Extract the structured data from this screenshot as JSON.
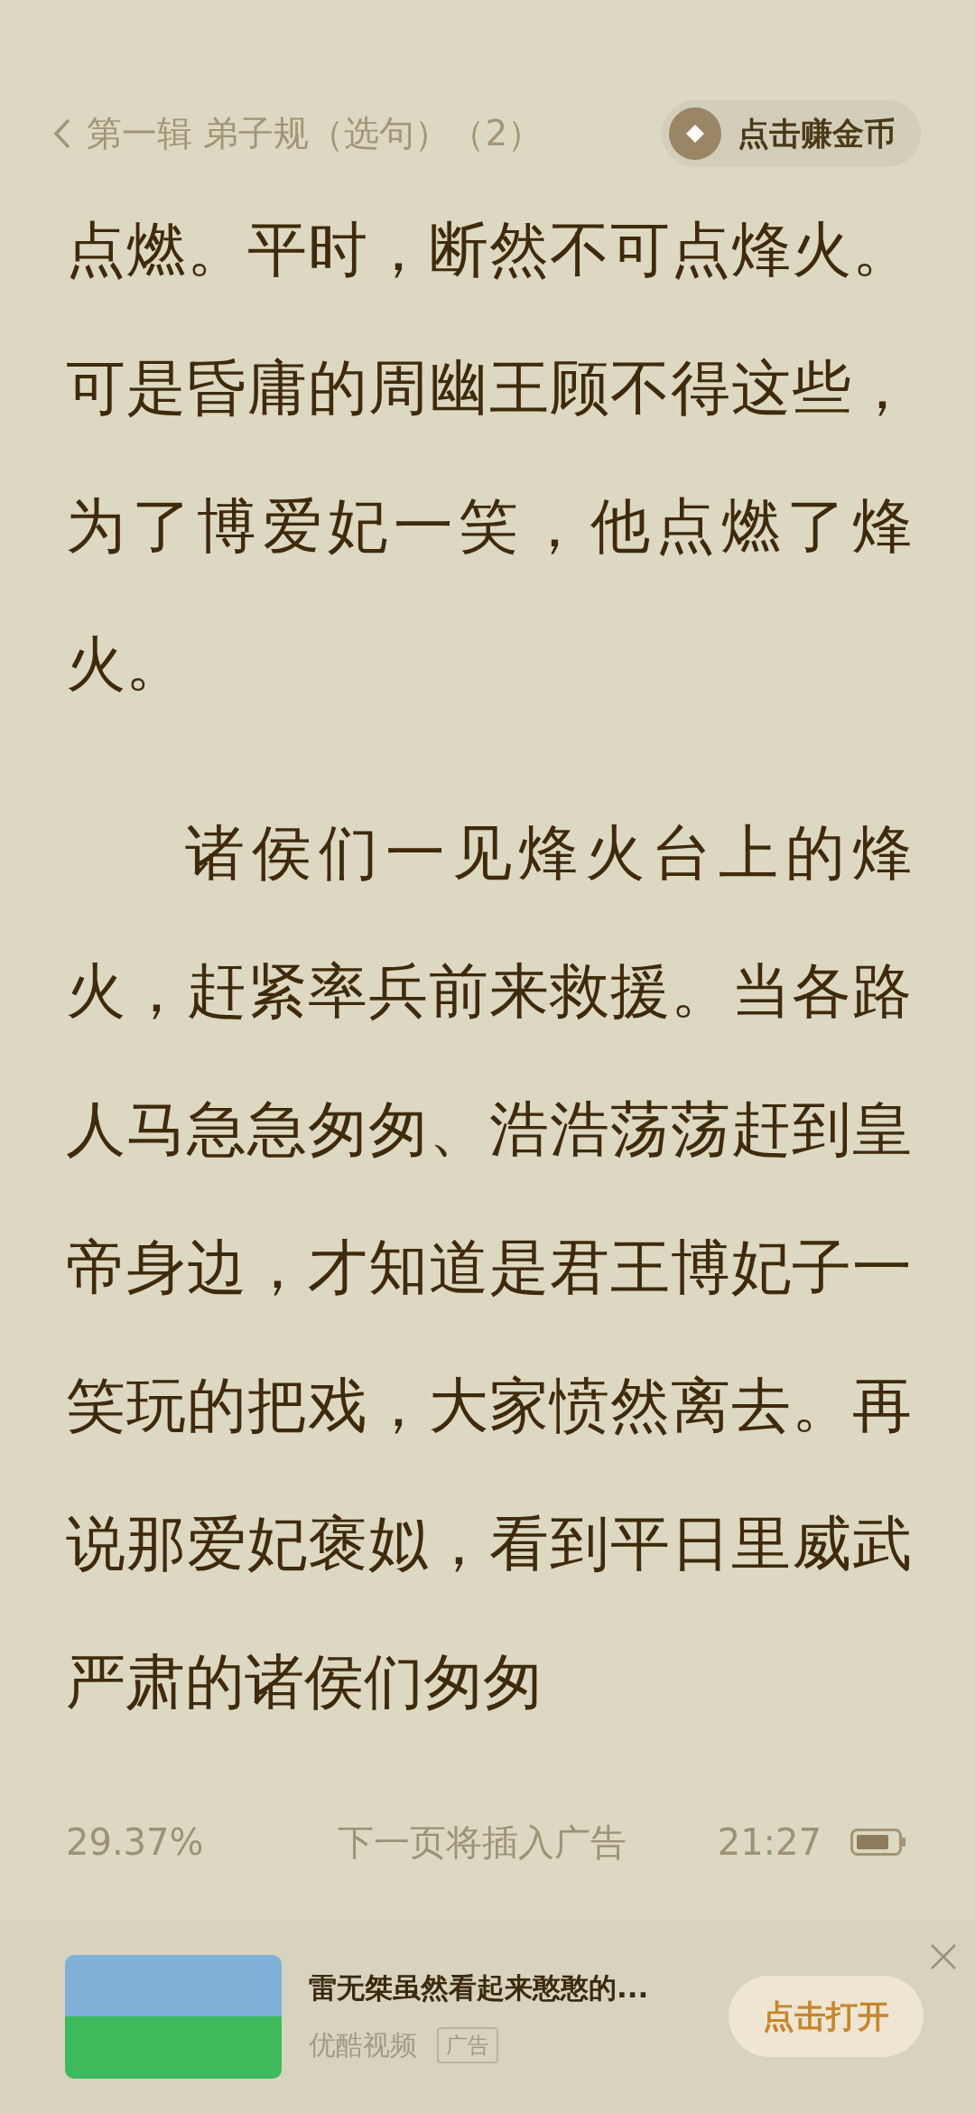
{
  "header": {
    "title": "第一辑 弟子规（选句）（2）",
    "coin_button": "点击赚金币"
  },
  "paragraphs": [
    {
      "text": "点燃。平时，断然不可点烽火。可是昏庸的周幽王顾不得这些，为了博爱妃一笑，他点燃了烽火。",
      "indent": false
    },
    {
      "text": "诸侯们一见烽火台上的烽火，赶紧率兵前来救援。当各路人马急急匆匆、浩浩荡荡赶到皇帝身边，才知道是君王博妃子一笑玩的把戏，大家愤然离去。再说那爱妃褒姒，看到平日里威武严肃的诸侯们匆匆",
      "indent": true
    }
  ],
  "status": {
    "progress": "29.37%",
    "notice": "下一页将插入广告",
    "time": "21:27"
  },
  "ad": {
    "title": "雷无桀虽然看起来憨憨的...",
    "source": "优酷视频",
    "tag": "广告",
    "button": "点击打开"
  }
}
